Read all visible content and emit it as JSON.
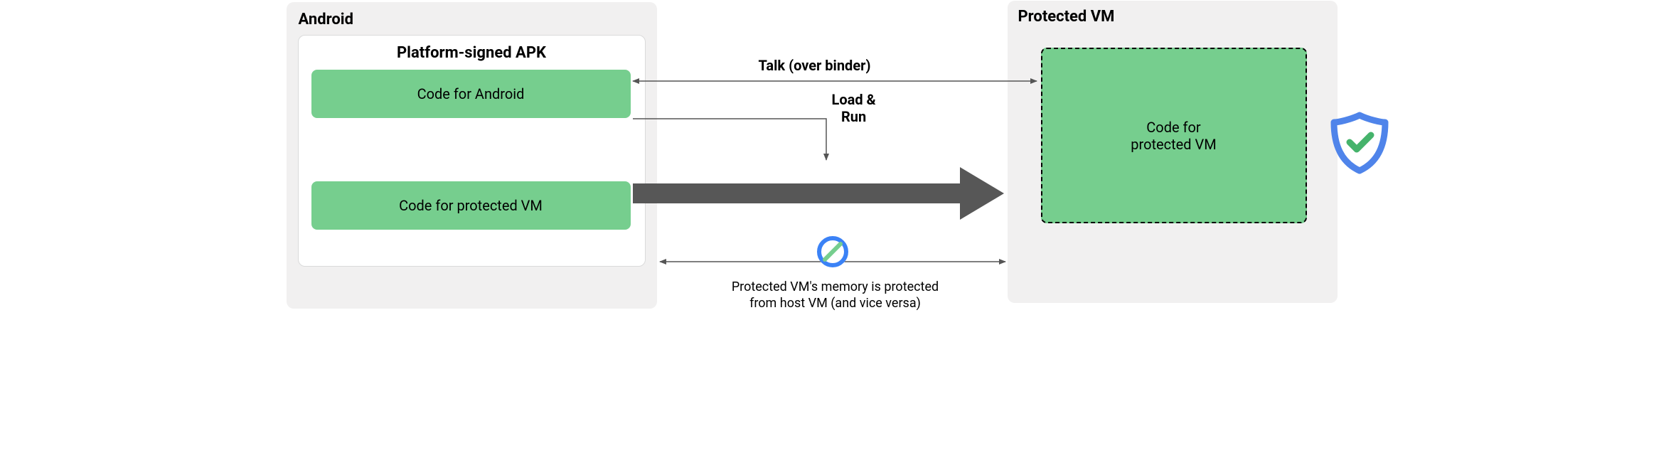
{
  "android": {
    "title": "Android",
    "apk_title": "Platform-signed APK",
    "code_android": "Code for Android",
    "code_pvm": "Code for protected VM"
  },
  "pvm": {
    "title": "Protected VM",
    "code_pvm": "Code for\nprotected VM"
  },
  "labels": {
    "talk": "Talk (over binder)",
    "load_run_1": "Load &",
    "load_run_2": "Run",
    "shielded_1": "Protected VM's memory is protected",
    "shielded_2": "from host VM (and vice versa)"
  },
  "icons": {
    "prohibit": "prohibit-icon",
    "shield": "shield-check-icon"
  }
}
